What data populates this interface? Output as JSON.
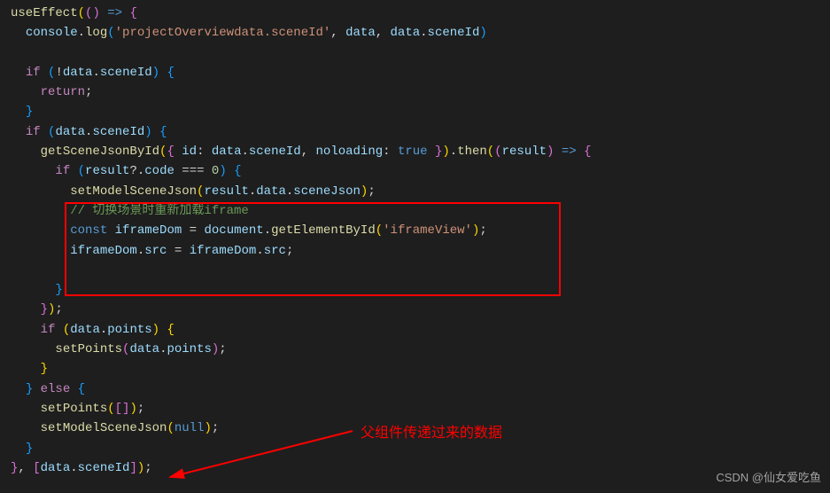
{
  "code": {
    "l1": "useEffect",
    "l1b": "() => {",
    "l2a": "console",
    "l2b": "log",
    "l2c": "'projectOverviewdata.sceneId'",
    "l2d": "data",
    "l2e": "data",
    "l2f": "sceneId",
    "l4a": "if",
    "l4b": "data",
    "l4c": "sceneId",
    "l5": "return",
    "l7a": "if",
    "l7b": "data",
    "l7c": "sceneId",
    "l8a": "getSceneJsonById",
    "l8b": "id",
    "l8c": "data",
    "l8d": "sceneId",
    "l8e": "noloading",
    "l8f": "true",
    "l8g": "then",
    "l8h": "result",
    "l9a": "if",
    "l9b": "result",
    "l9c": "code",
    "l9d": "0",
    "l10a": "setModelSceneJson",
    "l10b": "result",
    "l10c": "data",
    "l10d": "sceneJson",
    "l11": "// 切换场景时重新加载iframe",
    "l12a": "const",
    "l12b": "iframeDom",
    "l12c": "document",
    "l12d": "getElementById",
    "l12e": "'iframeView'",
    "l13a": "iframeDom",
    "l13b": "src",
    "l13c": "iframeDom",
    "l13d": "src",
    "l17a": "if",
    "l17b": "data",
    "l17c": "points",
    "l18a": "setPoints",
    "l18b": "data",
    "l18c": "points",
    "l20": "else",
    "l21a": "setPoints",
    "l22a": "setModelSceneJson",
    "l22b": "null",
    "l24a": "data",
    "l24b": "sceneId"
  },
  "annotation_text": "父组件传递过来的数据",
  "watermark": "CSDN @仙女爱吃鱼"
}
